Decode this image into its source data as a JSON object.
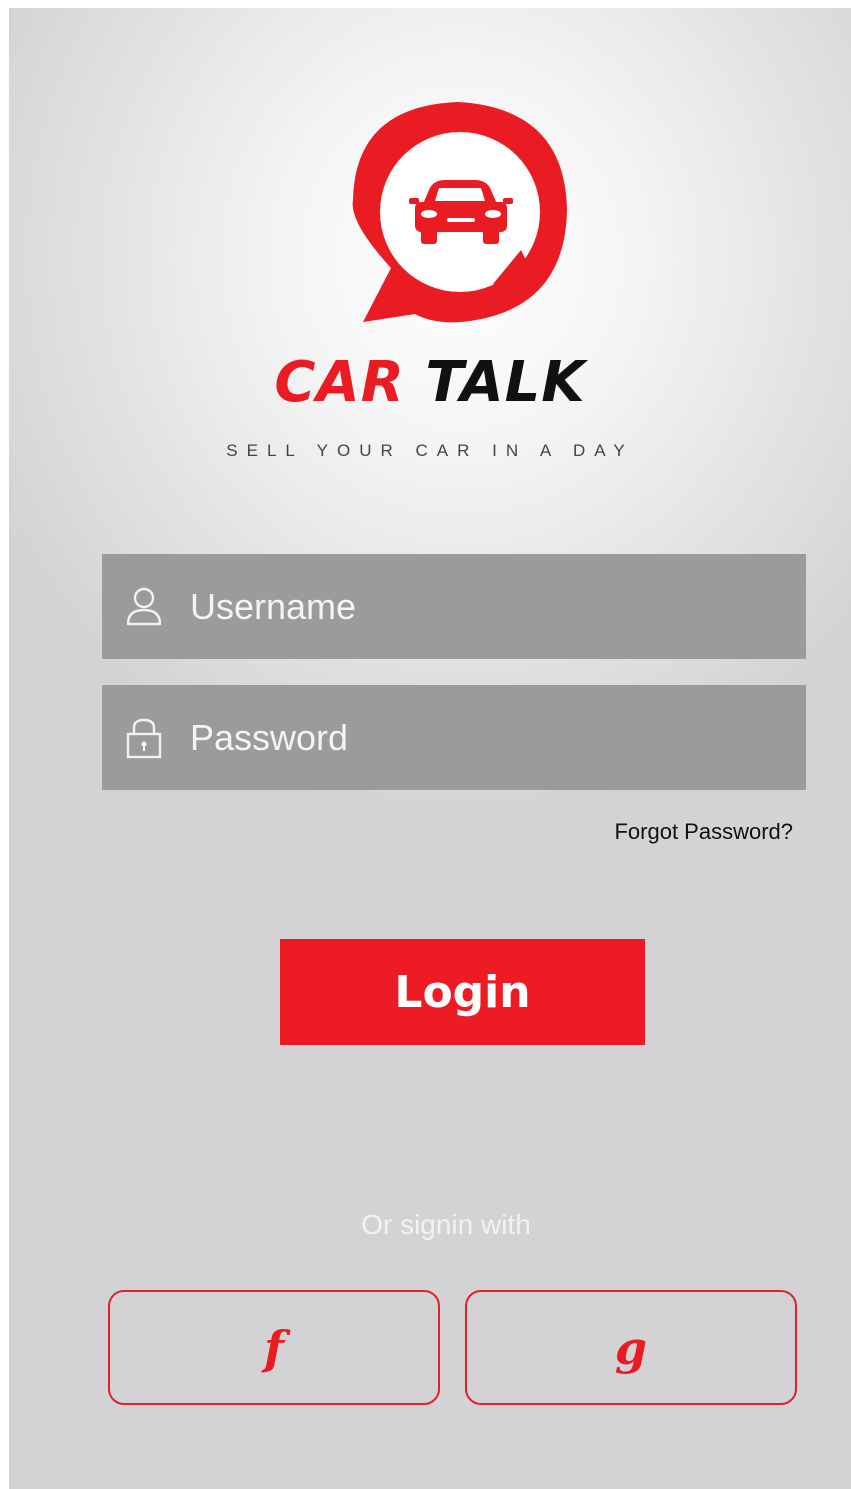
{
  "app": {
    "brand_part1": "CAR",
    "brand_part2": "TALK",
    "tagline": "SELL YOUR CAR IN A DAY"
  },
  "form": {
    "username_placeholder": "Username",
    "password_placeholder": "Password",
    "forgot_label": "Forgot Password?",
    "login_label": "Login"
  },
  "social": {
    "or_text": "Or signin with",
    "facebook_label": "f",
    "google_label": "g"
  },
  "icons": {
    "logo": "car-chat-bubble-logo",
    "username": "user-icon",
    "password": "lock-icon"
  },
  "colors": {
    "accent": "#ed1c24",
    "field_bg": "#9c9a9b",
    "brand_dark": "#111111"
  }
}
